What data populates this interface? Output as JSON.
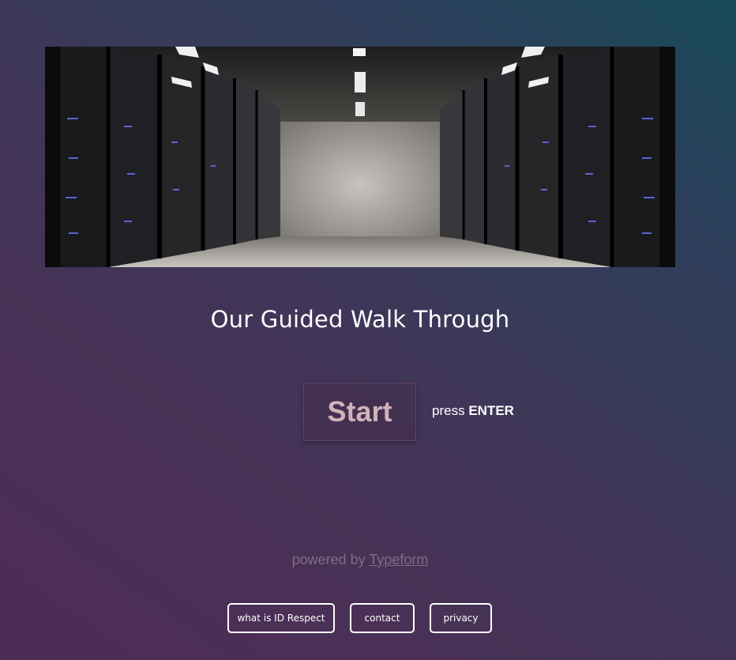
{
  "hero": {
    "image_alt": "server room corridor with racks"
  },
  "title": "Our Guided Walk Through",
  "start": {
    "label": "Start",
    "hint_prefix": "press",
    "hint_key": "ENTER"
  },
  "powered": {
    "prefix": "powered by",
    "link": "Typeform"
  },
  "footer": {
    "items": [
      "what is ID Respect",
      "contact",
      "privacy"
    ]
  }
}
